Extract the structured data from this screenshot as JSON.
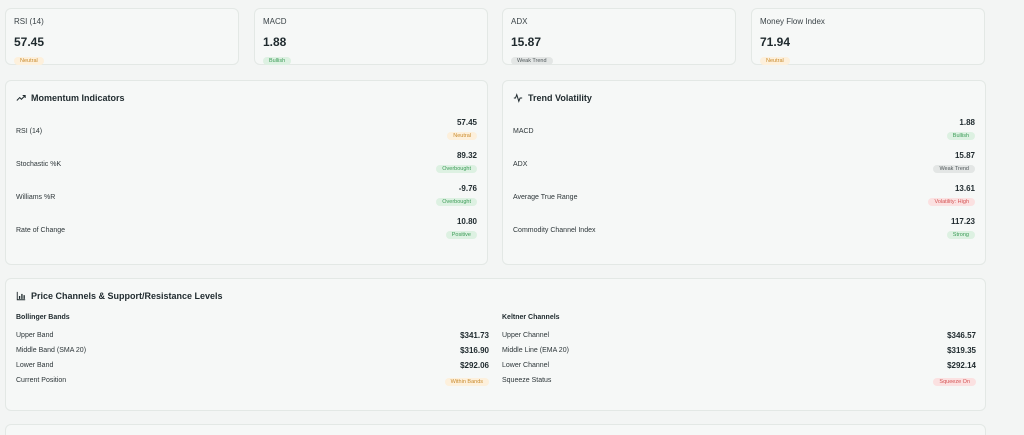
{
  "stats": [
    {
      "label": "RSI (14)",
      "value": "57.45",
      "badge": "Neutral"
    },
    {
      "label": "MACD",
      "value": "1.88",
      "badge": "Bullish"
    },
    {
      "label": "ADX",
      "value": "15.87",
      "badge": "Weak Trend"
    },
    {
      "label": "Money Flow Index",
      "value": "71.94",
      "badge": "Neutral"
    }
  ],
  "momentum": {
    "title": "Momentum Indicators",
    "rows": [
      {
        "name": "RSI (14)",
        "value": "57.45",
        "badge": "Neutral"
      },
      {
        "name": "Stochastic %K",
        "value": "89.32",
        "badge": "Overbought"
      },
      {
        "name": "Williams %R",
        "value": "-9.76",
        "badge": "Overbought"
      },
      {
        "name": "Rate of Change",
        "value": "10.80",
        "badge": "Positive"
      }
    ]
  },
  "volatility": {
    "title": "Trend Volatility",
    "rows": [
      {
        "name": "MACD",
        "value": "1.88",
        "badge": "Bullish"
      },
      {
        "name": "ADX",
        "value": "15.87",
        "badge": "Weak Trend"
      },
      {
        "name": "Average True Range",
        "value": "13.61",
        "badge": "Volatility: High"
      },
      {
        "name": "Commodity Channel Index",
        "value": "117.23",
        "badge": "Strong"
      }
    ]
  },
  "channels": {
    "title": "Price Channels & Support/Resistance Levels",
    "bollinger": {
      "heading": "Bollinger Bands",
      "rows": [
        {
          "name": "Upper Band",
          "value": "$341.73"
        },
        {
          "name": "Middle Band (SMA 20)",
          "value": "$316.90"
        },
        {
          "name": "Lower Band",
          "value": "$292.06"
        },
        {
          "name": "Current Position",
          "badge": "Within Bands"
        }
      ]
    },
    "keltner": {
      "heading": "Keltner Channels",
      "rows": [
        {
          "name": "Upper Channel",
          "value": "$346.57"
        },
        {
          "name": "Middle Line (EMA 20)",
          "value": "$319.35"
        },
        {
          "name": "Lower Channel",
          "value": "$292.14"
        },
        {
          "name": "Squeeze Status",
          "badge": "Squeeze On"
        }
      ]
    }
  },
  "colors": {
    "neutral": "#c98a2b",
    "positive": "#3a9b55",
    "negative": "#d45252",
    "muted": "#4f5759"
  },
  "icons": {
    "momentum": "trending-up-icon",
    "volatility": "activity-icon",
    "channels": "bar-chart-icon"
  }
}
